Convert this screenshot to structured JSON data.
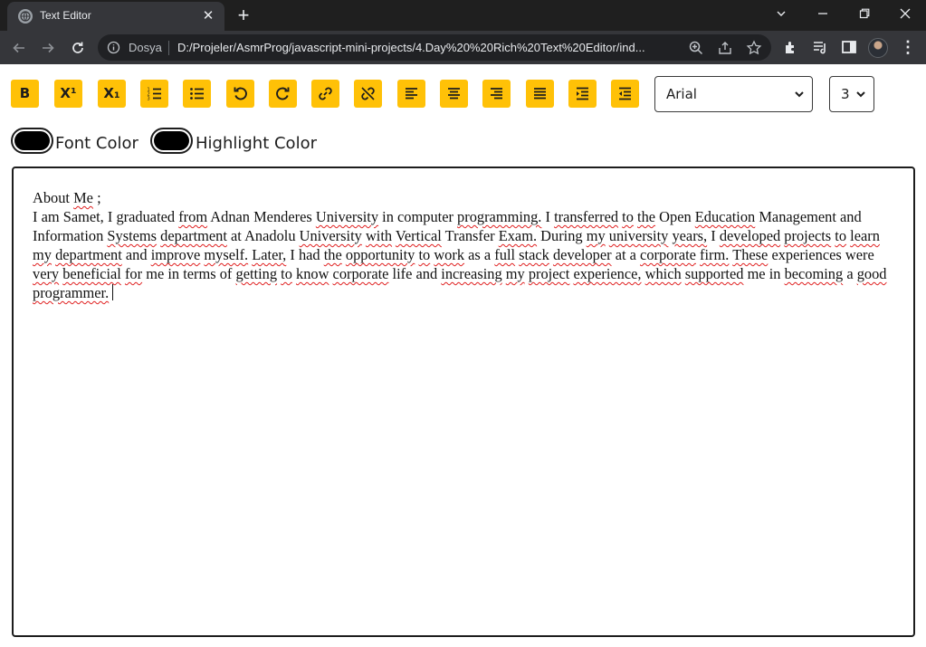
{
  "browser": {
    "tab_title": "Text Editor",
    "new_tab": "+",
    "scheme_label": "Dosya",
    "url": "D:/Projeler/AsmrProg/javascript-mini-projects/4.Day%20%20Rich%20Text%20Editor/ind..."
  },
  "toolbar": {
    "bold_label": "B",
    "superscript_label": "X¹",
    "subscript_label": "X₁",
    "accent_color": "#ffc107",
    "font_select": {
      "value": "Arial"
    },
    "size_select": {
      "value": "3"
    }
  },
  "colors": {
    "font_color_label": "Font Color",
    "highlight_color_label": "Highlight Color",
    "font_color_value": "#000000",
    "highlight_color_value": "#000000"
  },
  "editor": {
    "heading": "About Me ;",
    "body": "I am Samet, I graduated from Adnan Menderes University in computer programming. I transferred to the Open Education Management and Information Systems department at Anadolu University with Vertical Transfer Exam. During my university years, I developed projects to learn my department and improve myself. Later, I had the opportunity to work as a full stack developer at a corporate firm. These experiences were very beneficial for me in terms of getting to know corporate life and increasing my project experience, which supported me in becoming a good programmer."
  }
}
